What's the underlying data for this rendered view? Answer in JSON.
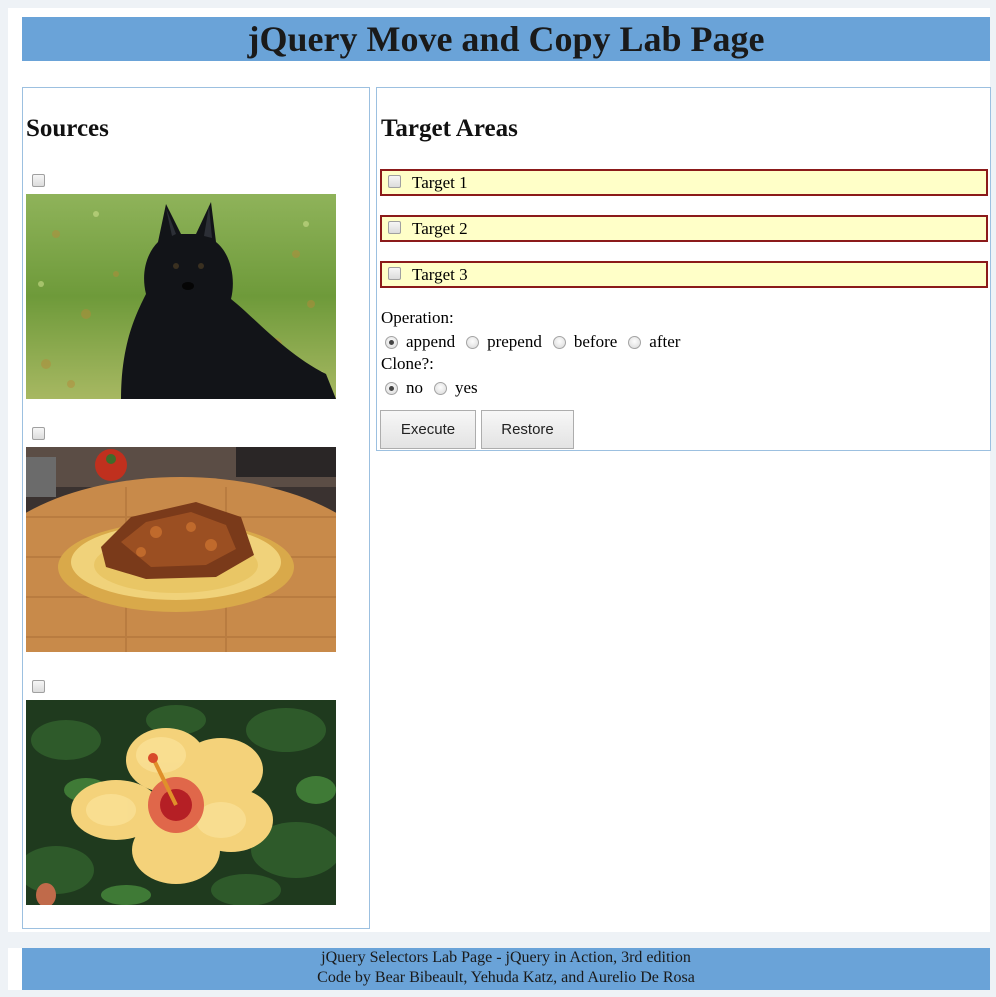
{
  "page": {
    "title": "jQuery Move and Copy Lab Page"
  },
  "sources": {
    "heading": "Sources",
    "items": [
      {
        "image": "dog-photo",
        "checked": false
      },
      {
        "image": "food-photo",
        "checked": false
      },
      {
        "image": "flower-photo",
        "checked": false
      }
    ]
  },
  "targets": {
    "heading": "Target Areas",
    "items": [
      {
        "label": "Target 1",
        "checked": false
      },
      {
        "label": "Target 2",
        "checked": false
      },
      {
        "label": "Target 3",
        "checked": false
      }
    ],
    "operation": {
      "label": "Operation:",
      "options": [
        "append",
        "prepend",
        "before",
        "after"
      ],
      "selected": "append"
    },
    "clone": {
      "label": "Clone?:",
      "options": [
        "no",
        "yes"
      ],
      "selected": "no"
    },
    "buttons": {
      "execute": "Execute",
      "restore": "Restore"
    }
  },
  "footer": {
    "line1": "jQuery Selectors Lab Page - jQuery in Action, 3rd edition",
    "line2": "Code by Bear Bibeault, Yehuda Katz, and Aurelio De Rosa"
  },
  "colors": {
    "banner": "#6aa3d8",
    "target_bg": "#ffffc8",
    "target_border": "#8b1a1a",
    "panel_border": "#9cc0e0"
  }
}
